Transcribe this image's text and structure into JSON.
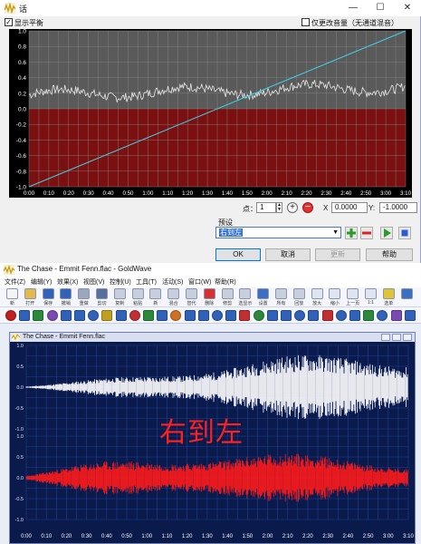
{
  "dialog": {
    "title": "话",
    "show_balance_label": "显示平衡",
    "show_balance_checked": true,
    "vol_only_label": "仅更改音量（无通道混音）",
    "vol_only_checked": false,
    "graph": {
      "y_ticks": [
        "1.0",
        "0.8",
        "0.6",
        "0.4",
        "0.2",
        "0.0",
        "-0.2",
        "-0.4",
        "-0.6",
        "-0.8",
        "-1.0"
      ],
      "x_ticks": [
        "0:00",
        "0:10",
        "0:20",
        "0:30",
        "0:40",
        "0:50",
        "1:00",
        "1:10",
        "1:20",
        "1:30",
        "1:40",
        "1:50",
        "2:00",
        "2:10",
        "2:20",
        "2:30",
        "2:40",
        "2:50",
        "3:00",
        "3:10"
      ],
      "balance_line": {
        "start": -1.0,
        "end": 1.0
      },
      "colors": {
        "positive_bg": "#5a5a5a",
        "negative_bg": "#7a1010",
        "line": "#40d0e8",
        "wave": "#e8e8e8"
      }
    },
    "point_label": "点：",
    "point_value": "1",
    "x_label": "X",
    "x_value": "0.0000",
    "y_label": "Y:",
    "y_value": "-1.0000",
    "preset_label": "预设",
    "preset_value": "右到左",
    "ok_label": "OK",
    "cancel_label": "取消",
    "update_label": "更新",
    "help_label": "帮助"
  },
  "goldwave": {
    "title": "The Chase - Emmit Fenn.flac - GoldWave",
    "menu": [
      "文件(Z)",
      "编辑(Y)",
      "效果(X)",
      "视图(V)",
      "控制(U)",
      "工具(T)",
      "活动(S)",
      "窗口(W)",
      "帮助(R)"
    ],
    "toolbar": [
      {
        "label": "新",
        "icon": "new-file-icon",
        "color": "#f4f4f4"
      },
      {
        "label": "打开",
        "icon": "open-folder-icon",
        "color": "#e4b94a"
      },
      {
        "label": "保存",
        "icon": "save-icon",
        "color": "#2f62b8"
      },
      {
        "label": "撤销",
        "icon": "undo-icon",
        "color": "#2f62b8"
      },
      {
        "label": "重做",
        "icon": "redo-icon",
        "color": "#9aa7bd"
      },
      {
        "label": "剪切",
        "icon": "cut-icon",
        "color": "#566f9e"
      },
      {
        "label": "复制",
        "icon": "copy-icon",
        "color": "#c8cfdc"
      },
      {
        "label": "粘贴",
        "icon": "paste-icon",
        "color": "#c8cfdc"
      },
      {
        "label": "新",
        "icon": "paste-new-icon",
        "color": "#c8cfdc"
      },
      {
        "label": "混合",
        "icon": "mix-icon",
        "color": "#c8cfdc"
      },
      {
        "label": "替代",
        "icon": "replace-icon",
        "color": "#c8cfdc"
      },
      {
        "label": "删除",
        "icon": "delete-icon",
        "color": "#d83030"
      },
      {
        "label": "修剪",
        "icon": "trim-icon",
        "color": "#c8cfdc"
      },
      {
        "label": "选显示",
        "icon": "select-view-icon",
        "color": "#c8cfdc"
      },
      {
        "label": "设置",
        "icon": "set-icon",
        "color": "#3a6fc6"
      },
      {
        "label": "所有",
        "icon": "all-icon",
        "color": "#c8cfdc"
      },
      {
        "label": "回放",
        "icon": "replay-icon",
        "color": "#c8cfdc"
      },
      {
        "label": "放大",
        "icon": "zoom-in-icon",
        "color": "#dfe5f0"
      },
      {
        "label": "缩小",
        "icon": "zoom-out-icon",
        "color": "#dfe5f0"
      },
      {
        "label": "上一页",
        "icon": "prev-page-icon",
        "color": "#dfe5f0"
      },
      {
        "label": "1:1",
        "icon": "zoom-1to1-icon",
        "color": "#dfe5f0"
      },
      {
        "label": "选单",
        "icon": "selection-icon",
        "color": "#e0c431"
      },
      {
        "label": "",
        "icon": "more-icon",
        "color": "#3a6fc6"
      }
    ],
    "effects_bar": [
      {
        "icon": "eq-icon",
        "color": "#c02020"
      },
      {
        "icon": "pan-icon",
        "color": "#2f62b8"
      },
      {
        "icon": "flip-icon",
        "color": "#2a8a3a"
      },
      {
        "icon": "invert-icon",
        "color": "#7a4ab0"
      },
      {
        "icon": "volume-icon",
        "color": "#2f62b8"
      },
      {
        "icon": "reverse-icon",
        "color": "#2f62b8"
      },
      {
        "icon": "mechanize-icon",
        "color": "#2f62b8"
      },
      {
        "icon": "spiral-icon",
        "color": "#c0a020"
      },
      {
        "icon": "flanger-icon",
        "color": "#2f62b8"
      },
      {
        "icon": "filter-icon",
        "color": "#c03030"
      },
      {
        "icon": "shape-icon",
        "color": "#2a8a3a"
      },
      {
        "icon": "resample-icon",
        "color": "#2f62b8"
      },
      {
        "icon": "doppler-icon",
        "color": "#d07020"
      },
      {
        "icon": "arrow-right-icon",
        "color": "#2f62b8"
      },
      {
        "icon": "arrow-left-icon",
        "color": "#2f62b8"
      },
      {
        "icon": "pitch-icon",
        "color": "#2f62b8"
      },
      {
        "icon": "equalizer-icon",
        "color": "#2f62b8"
      },
      {
        "icon": "noise-icon",
        "color": "#c03030"
      },
      {
        "icon": "compressor-icon",
        "color": "#2a8a3a"
      },
      {
        "icon": "book-icon",
        "color": "#2f62b8"
      },
      {
        "icon": "channel-icon",
        "color": "#2f62b8"
      },
      {
        "icon": "offset-icon",
        "color": "#2f62b8"
      },
      {
        "icon": "auto-gain-icon",
        "color": "#2f62b8"
      },
      {
        "icon": "spectrum-icon",
        "color": "#c03030"
      },
      {
        "icon": "fade-in-icon",
        "color": "#2f62b8"
      },
      {
        "icon": "fade-out-icon",
        "color": "#2f62b8"
      },
      {
        "icon": "bars-icon",
        "color": "#2a8a3a"
      },
      {
        "icon": "blocks-icon",
        "color": "#2f62b8"
      },
      {
        "icon": "cd-icon",
        "color": "#7a4ab0"
      },
      {
        "icon": "play-icon",
        "color": "#2f62b8"
      }
    ],
    "sound_window": {
      "title": "The Chase - Emmit Fenn.flac",
      "y_ticks": [
        "1.0",
        "0.5",
        "0.0",
        "-0.5",
        "-1.0"
      ],
      "x_ticks": [
        "0:00",
        "0:10",
        "0:20",
        "0:30",
        "0:40",
        "0:50",
        "1:00",
        "1:10",
        "1:20",
        "1:30",
        "1:40",
        "1:50",
        "2:00",
        "2:10",
        "2:20",
        "2:30",
        "2:40",
        "2:50",
        "3:00",
        "3:10"
      ],
      "left_color": "#ffffff",
      "right_color": "#ff1a1a",
      "grid_color": "#1f3f9a",
      "background": "#0a1a4a"
    },
    "overlay_caption": "右到左"
  }
}
